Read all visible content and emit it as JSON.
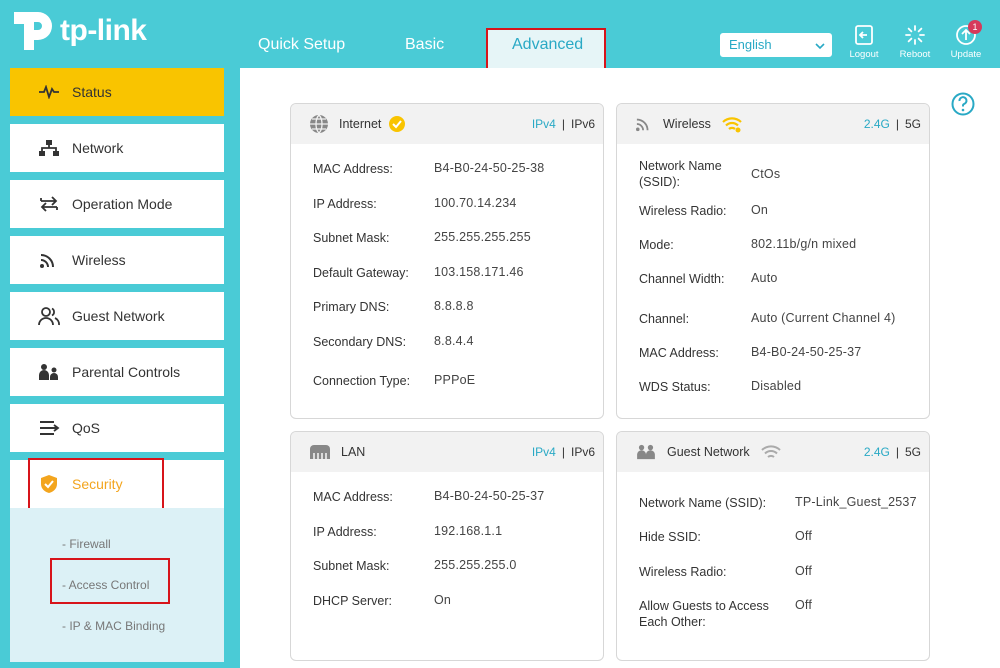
{
  "brand": {
    "name": "tp-link"
  },
  "nav": {
    "tabs": [
      {
        "label": "Quick Setup"
      },
      {
        "label": "Basic"
      },
      {
        "label": "Advanced"
      }
    ]
  },
  "header": {
    "language": "English",
    "logout": "Logout",
    "reboot": "Reboot",
    "update": "Update",
    "update_badge": "1"
  },
  "sidebar": {
    "items": [
      {
        "label": "Status",
        "icon": "pulse-icon"
      },
      {
        "label": "Network",
        "icon": "network-icon"
      },
      {
        "label": "Operation Mode",
        "icon": "operation-mode-icon"
      },
      {
        "label": "Wireless",
        "icon": "wireless-icon"
      },
      {
        "label": "Guest Network",
        "icon": "guest-icon"
      },
      {
        "label": "Parental Controls",
        "icon": "parental-icon"
      },
      {
        "label": "QoS",
        "icon": "qos-icon"
      },
      {
        "label": "Security",
        "icon": "shield-icon"
      }
    ],
    "security_sub": [
      {
        "label": "Firewall"
      },
      {
        "label": "Access Control"
      },
      {
        "label": "IP & MAC Binding"
      }
    ]
  },
  "cards": {
    "internet": {
      "title": "Internet",
      "band_a": "IPv4",
      "band_b": "IPv6",
      "rows": [
        {
          "label": "MAC Address:",
          "value": "B4-B0-24-50-25-38"
        },
        {
          "label": "IP Address:",
          "value": "100.70.14.234"
        },
        {
          "label": "Subnet Mask:",
          "value": "255.255.255.255"
        },
        {
          "label": "Default Gateway:",
          "value": "103.158.171.46"
        },
        {
          "label": "Primary DNS:",
          "value": "8.8.8.8"
        },
        {
          "label": "Secondary DNS:",
          "value": "8.8.4.4"
        },
        {
          "label": "Connection Type:",
          "value": "PPPoE"
        }
      ]
    },
    "wireless": {
      "title": "Wireless",
      "band_a": "2.4G",
      "band_b": "5G",
      "rows": [
        {
          "label": "Network Name (SSID):",
          "value": "CtOs"
        },
        {
          "label": "Wireless Radio:",
          "value": "On"
        },
        {
          "label": "Mode:",
          "value": "802.11b/g/n mixed"
        },
        {
          "label": "Channel Width:",
          "value": "Auto"
        },
        {
          "label": "Channel:",
          "value": "Auto (Current Channel 4)"
        },
        {
          "label": "MAC Address:",
          "value": "B4-B0-24-50-25-37"
        },
        {
          "label": "WDS Status:",
          "value": "Disabled"
        }
      ]
    },
    "lan": {
      "title": "LAN",
      "band_a": "IPv4",
      "band_b": "IPv6",
      "rows": [
        {
          "label": "MAC Address:",
          "value": "B4-B0-24-50-25-37"
        },
        {
          "label": "IP Address:",
          "value": "192.168.1.1"
        },
        {
          "label": "Subnet Mask:",
          "value": "255.255.255.0"
        },
        {
          "label": "DHCP Server:",
          "value": "On"
        }
      ]
    },
    "guest": {
      "title": "Guest Network",
      "band_a": "2.4G",
      "band_b": "5G",
      "rows": [
        {
          "label": "Network Name (SSID):",
          "value": "TP-Link_Guest_2537"
        },
        {
          "label": "Hide SSID:",
          "value": "Off"
        },
        {
          "label": "Wireless Radio:",
          "value": "Off"
        },
        {
          "label": "Allow Guests to Access Each Other:",
          "value": "Off"
        }
      ]
    }
  },
  "colors": {
    "accent": "#4acbd6",
    "active": "#f9c400",
    "highlight": "#d7141a",
    "link": "#29a9c5"
  }
}
